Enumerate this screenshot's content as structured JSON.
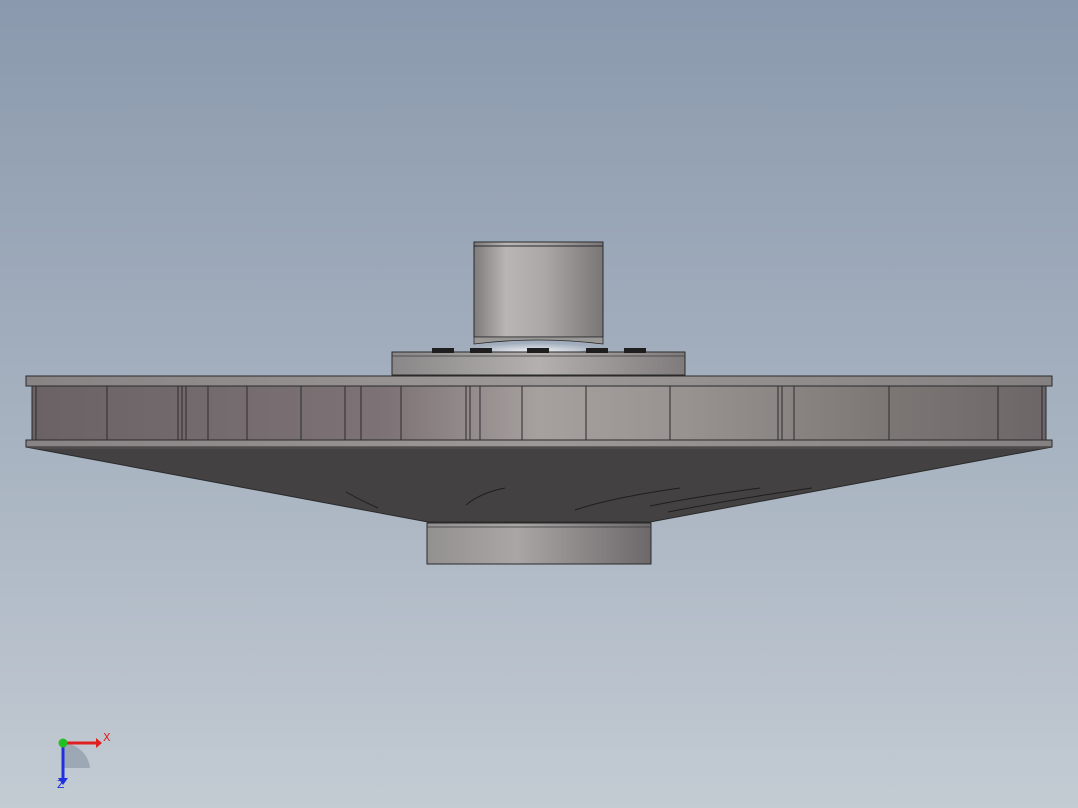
{
  "viewport": {
    "background_top": "#8a99ad",
    "background_bottom": "#c3cbd3"
  },
  "model": {
    "body_color": "#6f6a6c",
    "cone_color": "#424041",
    "shaft_color": "#a9a6a6"
  },
  "triad": {
    "x_label": "X",
    "z_label": "Z",
    "x_color": "#e02020",
    "y_color": "#20c020",
    "z_color": "#2030e0"
  }
}
